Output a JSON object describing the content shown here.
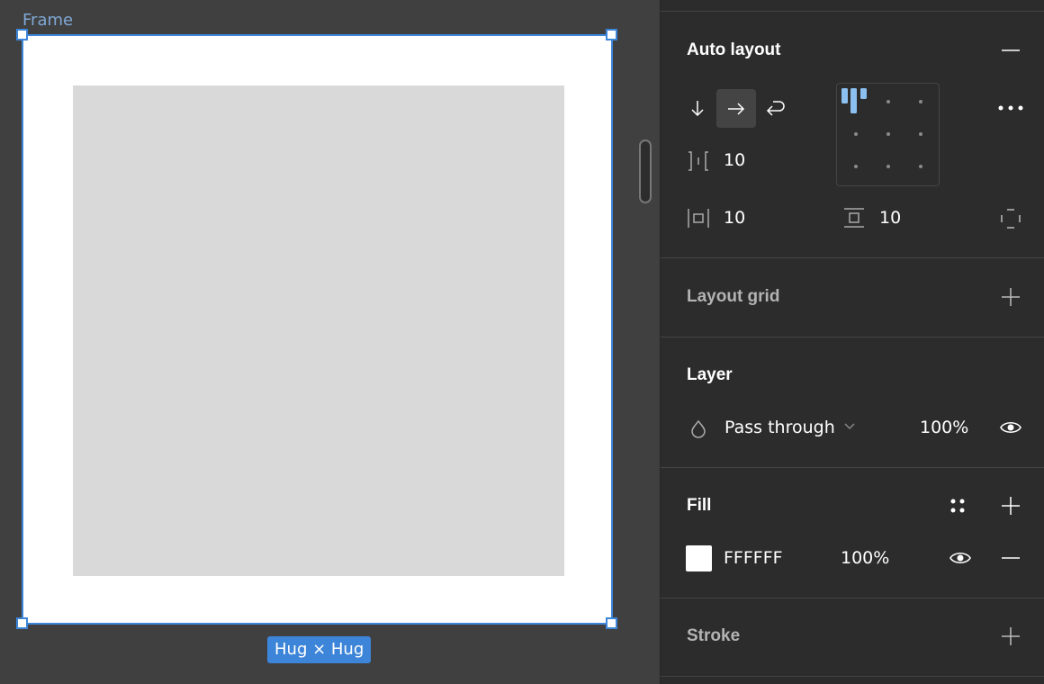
{
  "canvas": {
    "frame_label": "Frame",
    "size_badge": "Hug × Hug",
    "frame_fill": "#FFFFFF",
    "child_fill": "#D9D9D9",
    "selection_color": "#3D85D8"
  },
  "panel": {
    "auto_layout": {
      "title": "Auto layout",
      "remove_icon": "minus-icon",
      "directions": [
        {
          "name": "vertical",
          "icon": "arrow-down-icon",
          "active": false
        },
        {
          "name": "horizontal",
          "icon": "arrow-right-icon",
          "active": true
        },
        {
          "name": "wrap",
          "icon": "wrap-icon",
          "active": false
        }
      ],
      "gap": "10",
      "horizontal_padding": "10",
      "vertical_padding": "10",
      "alignment": "top-left",
      "more_icon": "more-icon",
      "independent_padding_icon": "padding-sides-icon"
    },
    "layout_grid": {
      "title": "Layout grid",
      "add_icon": "plus-icon"
    },
    "layer": {
      "title": "Layer",
      "blend_mode": "Pass through",
      "opacity": "100%",
      "visible": true
    },
    "fill": {
      "title": "Fill",
      "color_hex": "FFFFFF",
      "swatch_color": "#FFFFFF",
      "opacity": "100%",
      "visible": true
    },
    "stroke": {
      "title": "Stroke",
      "add_icon": "plus-icon"
    }
  }
}
